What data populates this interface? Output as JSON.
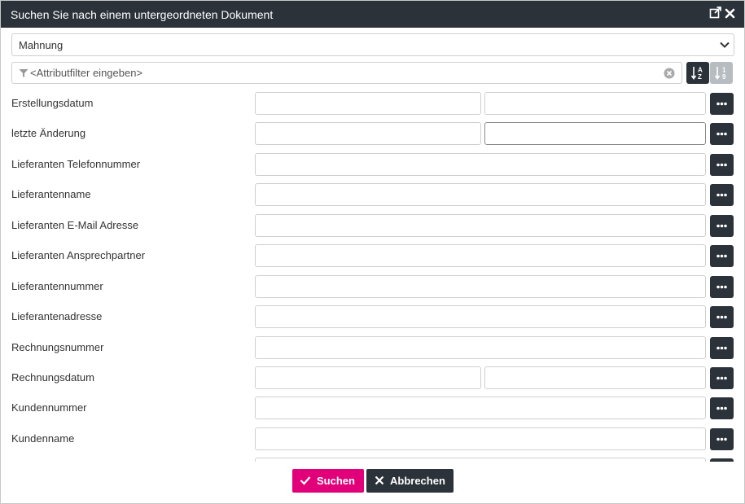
{
  "dialog": {
    "title": "Suchen Sie nach einem untergeordneten Dokument",
    "icons": {
      "popout": "popout-icon",
      "close": "close-icon"
    }
  },
  "doctype": {
    "selected": "Mahnung"
  },
  "filter": {
    "placeholder": "<Attributfilter eingeben>",
    "value": ""
  },
  "sort": {
    "alpha_icon": "sort-alpha-icon",
    "numeric_icon": "sort-numeric-icon"
  },
  "fields": [
    {
      "label": "Erstellungsdatum",
      "kind": "range"
    },
    {
      "label": "letzte Änderung",
      "kind": "range"
    },
    {
      "label": "Lieferanten Telefonnummer",
      "kind": "single"
    },
    {
      "label": "Lieferantenname",
      "kind": "single"
    },
    {
      "label": "Lieferanten E-Mail Adresse",
      "kind": "single"
    },
    {
      "label": "Lieferanten Ansprechpartner",
      "kind": "single"
    },
    {
      "label": "Lieferantennummer",
      "kind": "single"
    },
    {
      "label": "Lieferantenadresse",
      "kind": "single"
    },
    {
      "label": "Rechnungsnummer",
      "kind": "single"
    },
    {
      "label": "Rechnungsdatum",
      "kind": "range"
    },
    {
      "label": "Kundennummer",
      "kind": "single"
    },
    {
      "label": "Kundenname",
      "kind": "single"
    }
  ],
  "buttons": {
    "search": "Suchen",
    "cancel": "Abbrechen"
  },
  "colors": {
    "header": "#2b323a",
    "accent": "#e2007a",
    "dark_button": "#2b323a",
    "inactive_button": "#b7bcc1"
  }
}
